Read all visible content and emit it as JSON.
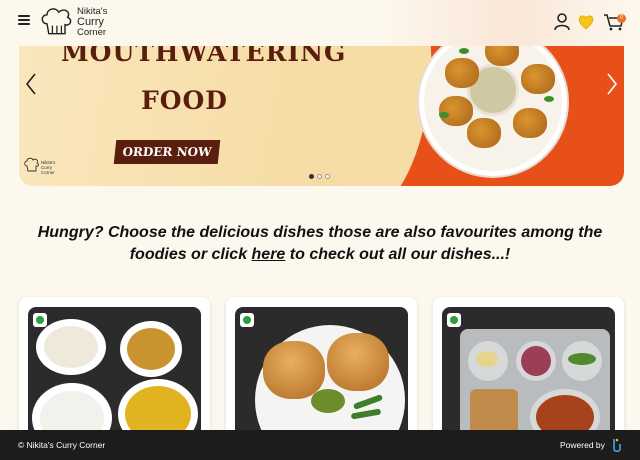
{
  "brand": {
    "name_line1": "Nikita's",
    "name_line2": "Curry",
    "name_line3": "Corner"
  },
  "header": {
    "menu_icon": "hamburger-menu-icon",
    "account_icon": "user-icon",
    "wishlist_icon": "heart-icon",
    "cart_icon": "cart-icon",
    "cart_count": "0",
    "accent_color": "#f5c518"
  },
  "banner": {
    "title_line1": "MOUTHWATERING",
    "title_line2": "FOOD",
    "cta_label": "ORDER NOW",
    "slide_count": 3,
    "active_slide": 1,
    "colors": {
      "bg": "#f6dca5",
      "accent": "#e8501a",
      "text": "#5a1e0e"
    }
  },
  "tagline": {
    "part1": "Hungry? Choose the delicious dishes those are also favourites among the foodies or click ",
    "link": "here",
    "part2": " to check out all our dishes...!"
  },
  "cards": [
    {
      "veg": true
    },
    {
      "veg": true
    },
    {
      "veg": true
    }
  ],
  "footer": {
    "copyright": "© Nikita's Curry Corner",
    "powered_by": "Powered by",
    "bg_color": "#1c1c1c"
  }
}
